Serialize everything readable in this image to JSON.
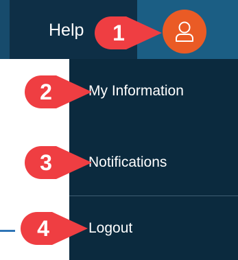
{
  "header": {
    "help_label": "Help",
    "avatar_icon": "user-icon"
  },
  "menu": {
    "items": [
      {
        "label": "My Information"
      },
      {
        "label": "Notifications"
      },
      {
        "label": "Logout"
      }
    ]
  },
  "callouts": [
    "1",
    "2",
    "3",
    "4"
  ],
  "colors": {
    "header_bg": "#0e2f46",
    "avatar_bg": "#ea5b25",
    "callout_red": "#ef3e42",
    "dropdown_bg": "#0b2a3e"
  }
}
